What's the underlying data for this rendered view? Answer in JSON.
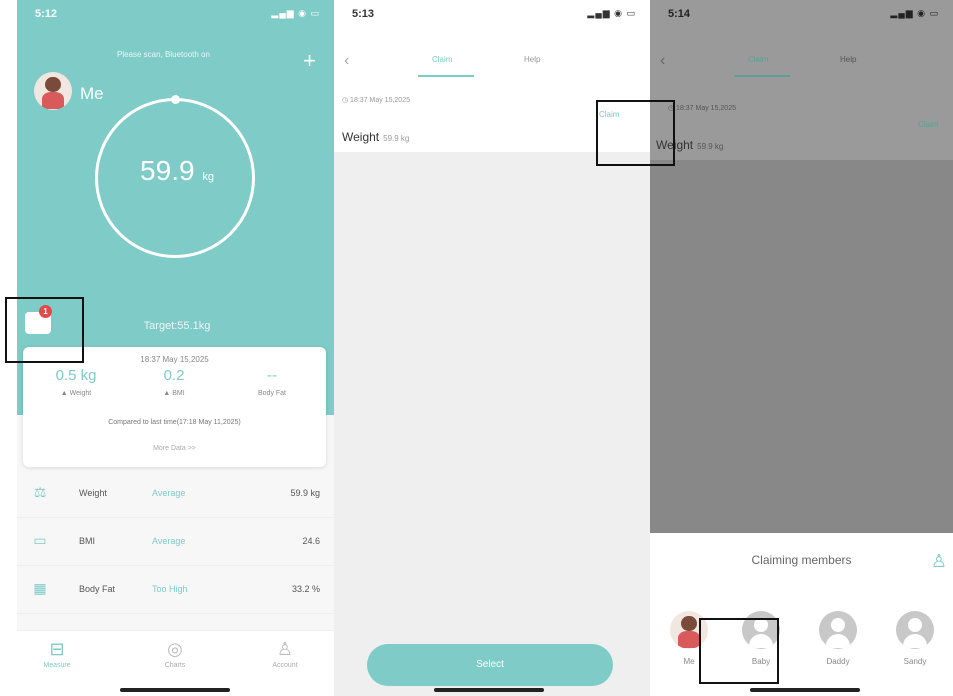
{
  "phone1": {
    "status_time": "5:12",
    "status_icons": "▂▄▆ ◉ ▭",
    "user_name": "Me",
    "hero_note": "Please scan, Bluetooth on",
    "plus_label": "+",
    "weight_value": "59.9",
    "weight_unit": "kg",
    "target_text": "Target:55.1kg",
    "mail_badge": "1",
    "card": {
      "date": "18:37 May 15,2025",
      "stats": [
        {
          "value": "0.5 kg",
          "label": "▲ Weight"
        },
        {
          "value": "0.2",
          "label": "▲ BMI"
        },
        {
          "value": "--",
          "label": "Body Fat"
        }
      ],
      "compare": "Compared to last time(17:18 May 11,2025)",
      "more": "More Data >>"
    },
    "metrics": [
      {
        "icon": "scale-icon",
        "name": "Weight",
        "status": "Average",
        "value": "59.9 kg"
      },
      {
        "icon": "bmi-icon",
        "name": "BMI",
        "status": "Average",
        "value": "24.6"
      },
      {
        "icon": "bodyfat-icon",
        "name": "Body Fat",
        "status": "Too High",
        "value": "33.2 %"
      }
    ],
    "tabs": [
      {
        "label": "Measure",
        "active": true
      },
      {
        "label": "Charts",
        "active": false
      },
      {
        "label": "Account",
        "active": false
      }
    ]
  },
  "phone2": {
    "status_time": "5:13",
    "status_icons": "▂▄▆ ◉ ▭",
    "back": "‹",
    "tabs": [
      {
        "label": "Claim",
        "active": true
      },
      {
        "label": "Help",
        "active": false
      }
    ],
    "record_date": "◷ 18:37 May 15,2025",
    "record_label": "Weight",
    "record_value": "59.9 kg",
    "claim_link": "Claim",
    "select_button": "Select"
  },
  "phone3": {
    "status_time": "5:14",
    "status_icons": "▂▄▆ ◉ ▭",
    "back": "‹",
    "tabs": [
      {
        "label": "Claim",
        "active": true
      },
      {
        "label": "Help",
        "active": false
      }
    ],
    "record_date": "◷ 18:37 May 15,2025",
    "record_label": "Weight",
    "record_value": "59.9 kg",
    "claim_link": "Claim",
    "sheet_title": "Claiming members",
    "members": [
      {
        "name": "Me"
      },
      {
        "name": "Baby"
      },
      {
        "name": "Daddy"
      },
      {
        "name": "Sandy"
      }
    ]
  },
  "colors": {
    "accent": "#7ecbc7",
    "badge": "#e24a4a"
  }
}
